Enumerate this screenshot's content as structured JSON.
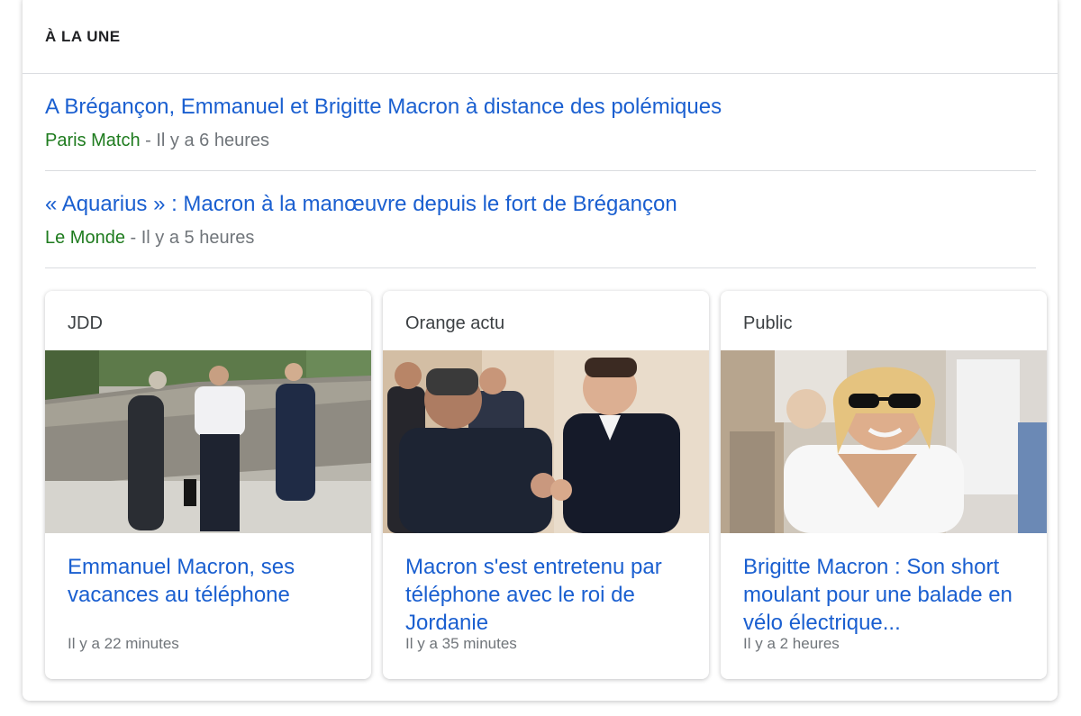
{
  "section": {
    "title": "À LA UNE"
  },
  "stories": [
    {
      "title": "A Brégançon, Emmanuel et Brigitte Macron à distance des polémiques",
      "source": "Paris Match",
      "separator": " - ",
      "time": "Il y a 6 heures"
    },
    {
      "title": "« Aquarius » : Macron à la manœuvre depuis le fort de Brégançon",
      "source": "Le Monde",
      "separator": " - ",
      "time": "Il y a 5 heures"
    }
  ],
  "cards": [
    {
      "source": "JDD",
      "headline": "Emmanuel Macron, ses vacances au téléphone",
      "time": "Il y a 22 minutes",
      "image_desc": "photo-men-on-terrace"
    },
    {
      "source": "Orange actu",
      "headline": "Macron s'est entretenu par téléphone avec le roi de Jordanie",
      "time": "Il y a 35 minutes",
      "image_desc": "photo-handshake"
    },
    {
      "source": "Public",
      "headline": "Brigitte Macron : Son short moulant pour une balade en vélo électrique...",
      "time": "Il y a 2 heures",
      "image_desc": "photo-woman-sunglasses"
    }
  ],
  "colors": {
    "link": "#1a5fd0",
    "source_green": "#1e7b1e",
    "meta_gray": "#70757a",
    "divider": "#dadce0"
  }
}
